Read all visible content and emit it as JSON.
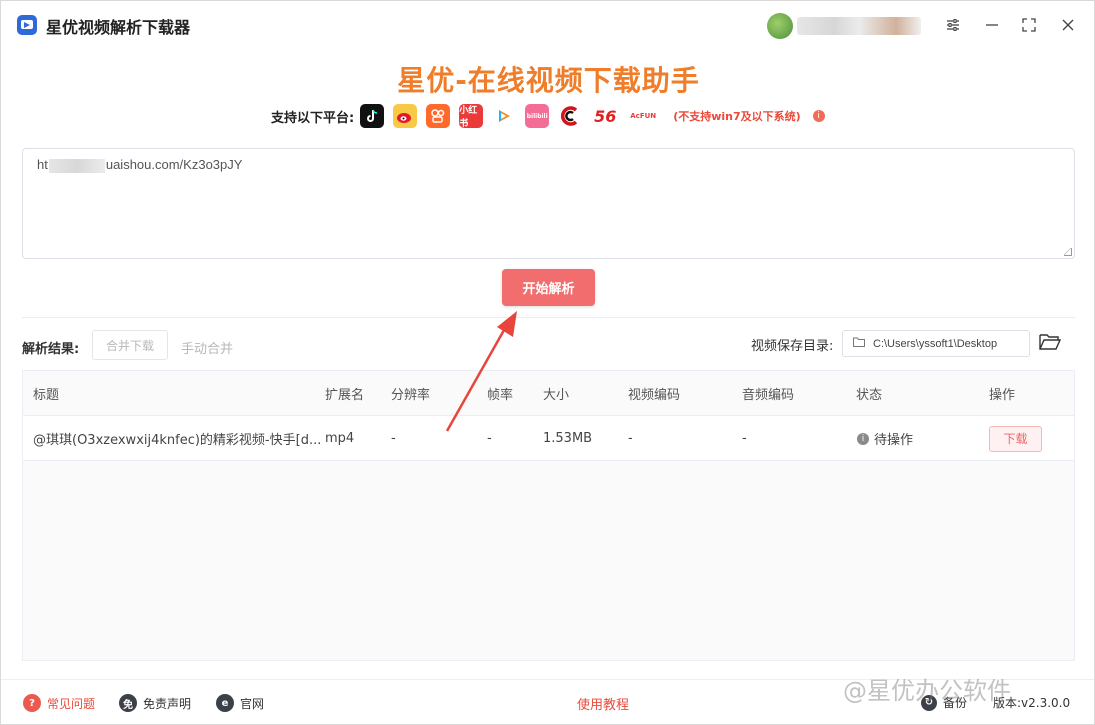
{
  "app": {
    "title": "星优视频解析下载器",
    "brand_title": "星优-在线视频下载助手"
  },
  "platforms": {
    "label": "支持以下平台:",
    "items": [
      "tiktok-icon",
      "weibo-icon",
      "kuaishou-icon",
      "xiaohongshu-icon",
      "tencent-video-icon",
      "bilibili-icon",
      "cctv-icon",
      "56-icon",
      "acfun-icon"
    ],
    "item_texts": {
      "xhs": "小红书",
      "bili": "bilibili",
      "n56": "56",
      "acfun": "AcFUN"
    },
    "note": "(不支持win7及以下系统)"
  },
  "url_input": {
    "value_prefix": "ht",
    "value_suffix": "uaishou.com/Kz3o3pJY"
  },
  "parse_button": "开始解析",
  "results": {
    "label": "解析结果:",
    "merge_download": "合并下载",
    "manual_merge": "手动合并",
    "save_dir_label": "视频保存目录:",
    "save_dir_value": "C:\\Users\\yssoft1\\Desktop"
  },
  "table": {
    "headers": [
      "标题",
      "扩展名",
      "分辨率",
      "帧率",
      "大小",
      "视频编码",
      "音频编码",
      "状态",
      "操作"
    ],
    "rows": [
      {
        "title": "@琪琪(O3xzexwxij4knfec)的精彩视频-快手[d...",
        "ext": "mp4",
        "resolution": "-",
        "fps": "-",
        "size": "1.53MB",
        "vcodec": "-",
        "acodec": "-",
        "status": "待操作",
        "action": "下载"
      }
    ]
  },
  "footer": {
    "faq": "常见问题",
    "disclaimer": "免责声明",
    "website": "官网",
    "tutorial": "使用教程",
    "backup": "备份",
    "version": "版本:v2.3.0.0",
    "watermark": "@星优办公软件"
  },
  "colors": {
    "accent": "#f26d6d",
    "brand": "#ef7d2a",
    "warning_text": "#ea4a3a"
  }
}
